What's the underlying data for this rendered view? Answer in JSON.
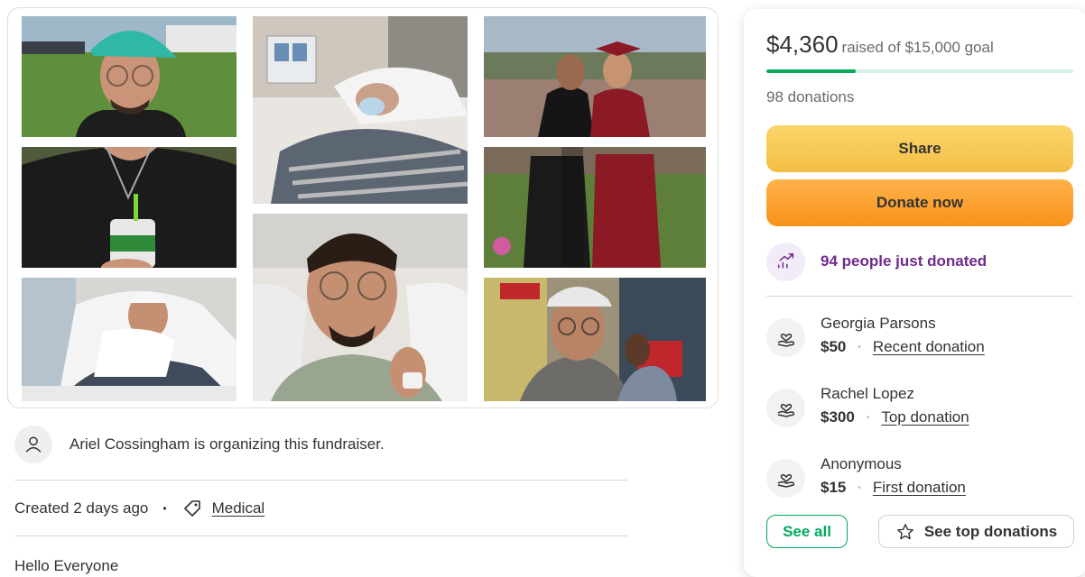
{
  "organizer": {
    "text": "Ariel Cossingham is organizing this fundraiser.",
    "avatar_icon": "user-outline-icon"
  },
  "meta": {
    "created": "Created 2 days ago",
    "separator": "•",
    "category": "Medical",
    "category_icon": "tag-icon"
  },
  "description_start": "Hello Everyone",
  "photos": [
    {
      "name": "photo-teal-cap-outdoors"
    },
    {
      "name": "photo-hospital-bed-oxygen-mask"
    },
    {
      "name": "photo-graduation"
    },
    {
      "name": "photo-black-shirt-drink"
    },
    {
      "name": "photo-graduation-field"
    },
    {
      "name": "photo-hospital-selfie-thumbs-up"
    },
    {
      "name": "photo-hospital-bed-bandaged"
    },
    {
      "name": "photo-restaurant-selfie"
    }
  ],
  "campaign": {
    "raised": "$4,360",
    "goal_text": "raised of $15,000 goal",
    "progress_fraction": 0.29,
    "donations_count": "98 donations",
    "share_label": "Share",
    "donate_label": "Donate now",
    "just_donated": "94 people just donated",
    "donors": [
      {
        "name": "Georgia Parsons",
        "amount": "$50",
        "sep": "•",
        "type": "Recent donation"
      },
      {
        "name": "Rachel Lopez",
        "amount": "$300",
        "sep": "•",
        "type": "Top donation"
      },
      {
        "name": "Anonymous",
        "amount": "$15",
        "sep": "•",
        "type": "First donation"
      }
    ],
    "see_all_label": "See all",
    "see_top_label": "See top donations"
  },
  "colors": {
    "brand_green": "#02a95c",
    "share_yellow": "#f4be45",
    "donate_orange": "#f7931a",
    "purple": "#6f2a8c"
  }
}
